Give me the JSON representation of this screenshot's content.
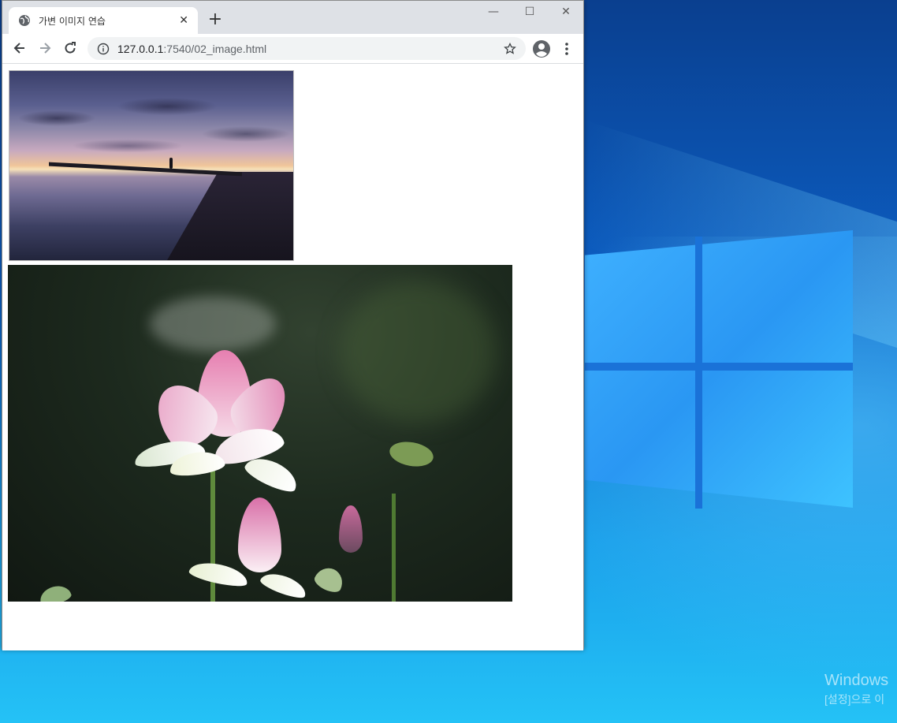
{
  "browser": {
    "tab": {
      "title": "가변 이미지 연습",
      "icon": "globe-icon"
    },
    "new_tab_label": "+",
    "window_controls": {
      "minimize": "—",
      "maximize": "☐",
      "close": "✕"
    },
    "toolbar": {
      "url_host": "127.0.0.1",
      "url_rest": ":7540/02_image.html"
    }
  },
  "page": {
    "images": [
      {
        "subject": "sunset-pier-photo"
      },
      {
        "subject": "lotus-flower-photo"
      }
    ]
  },
  "desktop": {
    "watermark_line1": "Windows",
    "watermark_line2": "[설정]으로 이"
  }
}
